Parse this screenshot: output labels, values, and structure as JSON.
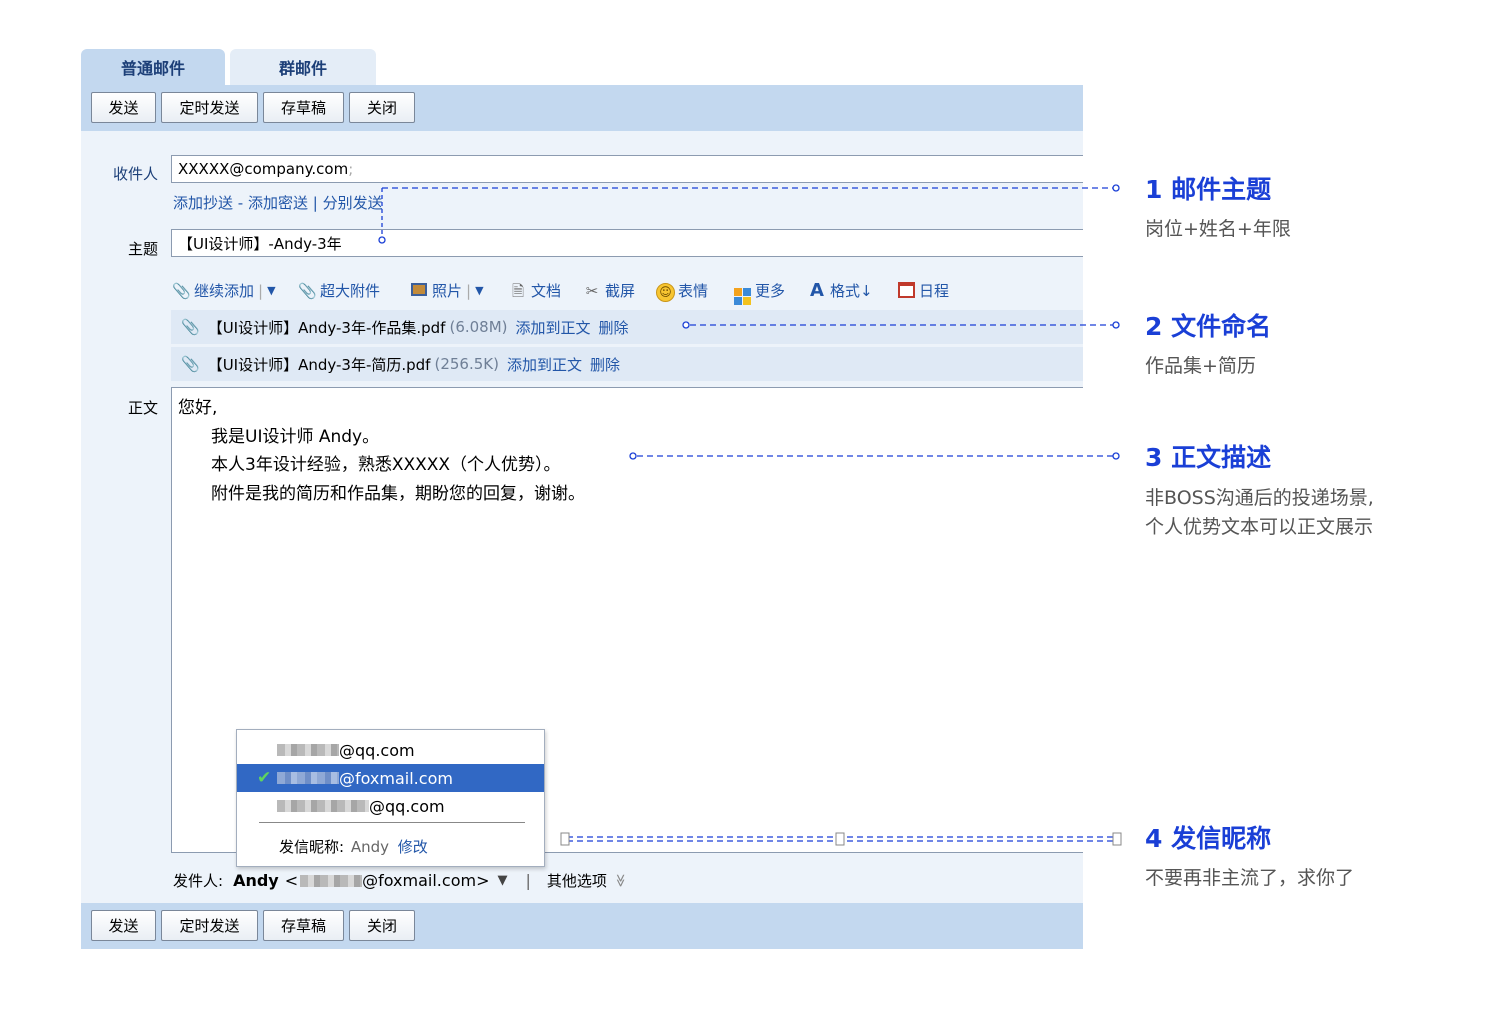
{
  "tabs": [
    {
      "label": "普通邮件",
      "active": true
    },
    {
      "label": "群邮件",
      "active": false
    }
  ],
  "toolbar": {
    "send": "发送",
    "scheduled_send": "定时发送",
    "save_draft": "存草稿",
    "close": "关闭"
  },
  "recipient": {
    "label": "收件人",
    "value": "XXXXX@company.com",
    "separator": ";",
    "add_cc": "添加抄送",
    "dash": "-",
    "add_bcc": "添加密送",
    "pipe": "|",
    "separate_send": "分别发送"
  },
  "subject": {
    "label": "主题",
    "value": "【UI设计师】-Andy-3年"
  },
  "attach_tools": {
    "continue_add": "继续添加",
    "large_attach": "超大附件",
    "photo": "照片",
    "document": "文档",
    "screenshot": "截屏",
    "emoji": "表情",
    "more": "更多",
    "format": "格式↓",
    "schedule": "日程"
  },
  "attachments": [
    {
      "name": "【UI设计师】Andy-3年-作品集.pdf",
      "size": "(6.08M)",
      "add_to_body": "添加到正文",
      "delete": "删除"
    },
    {
      "name": "【UI设计师】Andy-3年-简历.pdf",
      "size": "(256.5K)",
      "add_to_body": "添加到正文",
      "delete": "删除"
    }
  ],
  "body": {
    "label": "正文",
    "lines": [
      "您好,",
      "我是UI设计师 Andy。",
      "本人3年设计经验，熟悉XXXXX（个人优势）。",
      "附件是我的简历和作品集，期盼您的回复，谢谢。"
    ]
  },
  "sender_dropdown": {
    "options": [
      {
        "suffix": "@qq.com",
        "selected": false
      },
      {
        "suffix": "@foxmail.com",
        "selected": true
      },
      {
        "suffix": "@qq.com",
        "selected": false
      }
    ],
    "nickname_label": "发信昵称:",
    "nickname_value": "Andy",
    "modify": "修改"
  },
  "sender": {
    "label": "发件人:",
    "name": "Andy",
    "open": "<",
    "email_suffix": "@foxmail.com>",
    "arrow": "▼",
    "pipe": "|",
    "other_options": "其他选项",
    "other_arrow": "≫"
  },
  "annotations": [
    {
      "title": "1 邮件主题",
      "desc": [
        "岗位+姓名+年限"
      ]
    },
    {
      "title": "2 文件命名",
      "desc": [
        "作品集+简历"
      ]
    },
    {
      "title": "3 正文描述",
      "desc": [
        "非BOSS沟通后的投递场景,",
        "个人优势文本可以正文展示"
      ]
    },
    {
      "title": "4 发信昵称",
      "desc": [
        "不要再非主流了，求你了"
      ]
    }
  ],
  "colors": {
    "accent": "#1a3fd6",
    "toolbar_bg": "#c3d8ef",
    "link": "#2256a8",
    "selected": "#3168c4"
  }
}
